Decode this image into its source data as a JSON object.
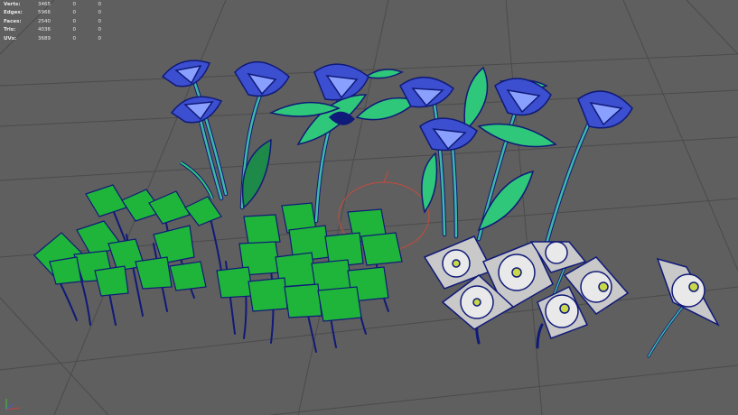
{
  "viewport": {
    "label": "3D viewport",
    "background": "#5f5f5f",
    "grid_color": "#4a4a4a",
    "wire_color": "#101a78",
    "stem_color": "#3fb8a8",
    "leaf_color": "#2fc77a",
    "clover_color": "#1fb53a",
    "petal_blue": "#3b4fd0",
    "petal_white": "#e9e9e9",
    "flower_center": "#c8d84a",
    "manipulator_color": "#c84a3c"
  },
  "hud": {
    "rows": [
      {
        "label": "Verts:",
        "value": "3465",
        "sel": "0",
        "sel2": "0"
      },
      {
        "label": "Edges:",
        "value": "5966",
        "sel": "0",
        "sel2": "0"
      },
      {
        "label": "Faces:",
        "value": "2540",
        "sel": "0",
        "sel2": "0"
      },
      {
        "label": "Tris:",
        "value": "4036",
        "sel": "0",
        "sel2": "0"
      },
      {
        "label": "UVs:",
        "value": "3689",
        "sel": "0",
        "sel2": "0"
      }
    ]
  },
  "axis_gizmo": {
    "icon": "axis-gizmo-icon"
  }
}
